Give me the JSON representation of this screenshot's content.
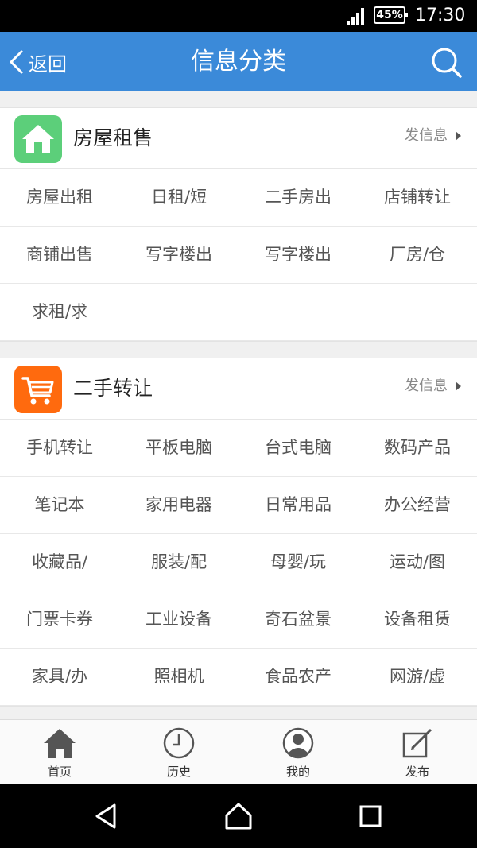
{
  "status_bar": {
    "battery": "45%",
    "time": "17:30"
  },
  "header": {
    "back_label": "返回",
    "title": "信息分类"
  },
  "sections": [
    {
      "title": "房屋租售",
      "post_label": "发信息",
      "icon": "house-icon",
      "icon_color": "#5ccf7a",
      "items": [
        "房屋出租",
        "日租/短",
        "二手房出",
        "店铺转让",
        "商铺出售",
        "写字楼出",
        "写字楼出",
        "厂房/仓",
        "求租/求"
      ]
    },
    {
      "title": "二手转让",
      "post_label": "发信息",
      "icon": "shopping-cart-icon",
      "icon_color": "#ff6a0e",
      "items": [
        "手机转让",
        "平板电脑",
        "台式电脑",
        "数码产品",
        "笔记本",
        "家用电器",
        "日常用品",
        "办公经营",
        "收藏品/",
        "服装/配",
        "母婴/玩",
        "运动/图",
        "门票卡券",
        "工业设备",
        "奇石盆景",
        "设备租赁",
        "家具/办",
        "照相机",
        "食品农产",
        "网游/虚"
      ]
    }
  ],
  "bottom_nav": [
    {
      "label": "首页",
      "icon": "home-icon"
    },
    {
      "label": "历史",
      "icon": "clock-icon"
    },
    {
      "label": "我的",
      "icon": "user-icon"
    },
    {
      "label": "发布",
      "icon": "edit-icon"
    }
  ],
  "colors": {
    "app_bar": "#3b8ad9",
    "house_icon": "#5ccf7a",
    "cart_icon": "#ff6a0e"
  }
}
